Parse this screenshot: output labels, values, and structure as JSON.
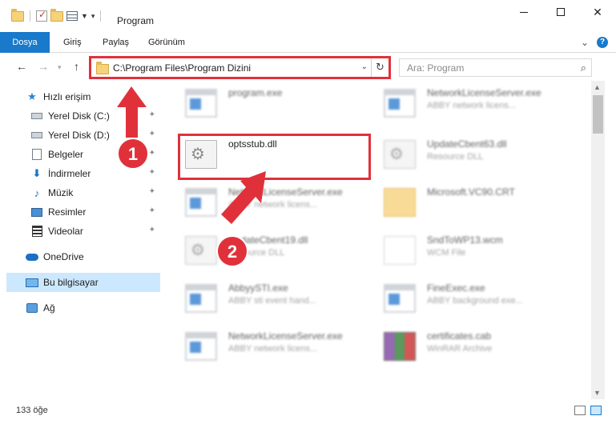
{
  "window": {
    "title": "Program",
    "buttons": {
      "minimize": "",
      "maximize": "",
      "close": "✕"
    }
  },
  "ribbon": {
    "tabs": [
      {
        "label": "Dosya"
      },
      {
        "label": "Giriş"
      },
      {
        "label": "Paylaş"
      },
      {
        "label": "Görünüm"
      }
    ],
    "expand_icon": "⌄",
    "help_icon": "?"
  },
  "nav": {
    "back": "←",
    "forward": "→",
    "up": "↑",
    "address": "C:\\Program Files\\Program Dizini",
    "address_caret": "⌄",
    "refresh": "↻",
    "search_placeholder": "Ara: Program",
    "search_icon": "⌕"
  },
  "sidebar": {
    "items": [
      {
        "label": "Hızlı erişim",
        "icon": "star-icon"
      },
      {
        "label": "Yerel Disk (C:)",
        "icon": "drive-icon",
        "pinned": true
      },
      {
        "label": "Yerel Disk (D:)",
        "icon": "drive-icon",
        "pinned": true
      },
      {
        "label": "Belgeler",
        "icon": "documents-icon",
        "pinned": true
      },
      {
        "label": "İndirmeler",
        "icon": "download-icon",
        "pinned": true
      },
      {
        "label": "Müzik",
        "icon": "music-icon",
        "pinned": true
      },
      {
        "label": "Resimler",
        "icon": "pictures-icon",
        "pinned": true
      },
      {
        "label": "Videolar",
        "icon": "videos-icon",
        "pinned": true
      },
      {
        "label": "OneDrive",
        "icon": "cloud-icon"
      },
      {
        "label": "Bu bilgisayar",
        "icon": "computer-icon",
        "selected": true
      },
      {
        "label": "Ağ",
        "icon": "network-icon"
      }
    ],
    "pin_glyph": "📌"
  },
  "files": [
    {
      "name": "program.exe",
      "desc": "",
      "type": "exe",
      "blurred": true
    },
    {
      "name": "NetworkLicenseServer.exe",
      "desc": "ABBY network licens...",
      "type": "exe",
      "blurred": true
    },
    {
      "name": "optsstub.dll",
      "desc": "",
      "type": "dll",
      "blurred": false
    },
    {
      "name": "UpdateCbent63.dll",
      "desc": "Resource DLL",
      "type": "dll",
      "blurred": true
    },
    {
      "name": "NetworkLicenseServer.exe",
      "desc": "ABBY network licens...",
      "type": "exe",
      "blurred": true
    },
    {
      "name": "Microsoft.VC90.CRT",
      "desc": "",
      "type": "folder",
      "blurred": true
    },
    {
      "name": "UpdateCbent19.dll",
      "desc": "Resource DLL",
      "type": "dll",
      "blurred": true
    },
    {
      "name": "SndToWP13.wcm",
      "desc": "WCM File",
      "type": "doc",
      "blurred": true
    },
    {
      "name": "AbbyySTI.exe",
      "desc": "ABBY sti event hand...",
      "type": "exe",
      "blurred": true
    },
    {
      "name": "FineExec.exe",
      "desc": "ABBY background exe...",
      "type": "exe",
      "blurred": true
    },
    {
      "name": "NetworkLicenseServer.exe",
      "desc": "ABBY network licens...",
      "type": "exe",
      "blurred": true
    },
    {
      "name": "certificates.cab",
      "desc": "WinRAR Archive",
      "type": "cab",
      "blurred": true
    }
  ],
  "status": {
    "count": "133 öğe"
  },
  "annotations": {
    "badge1": "1",
    "badge2": "2",
    "color": "#e0313b"
  }
}
